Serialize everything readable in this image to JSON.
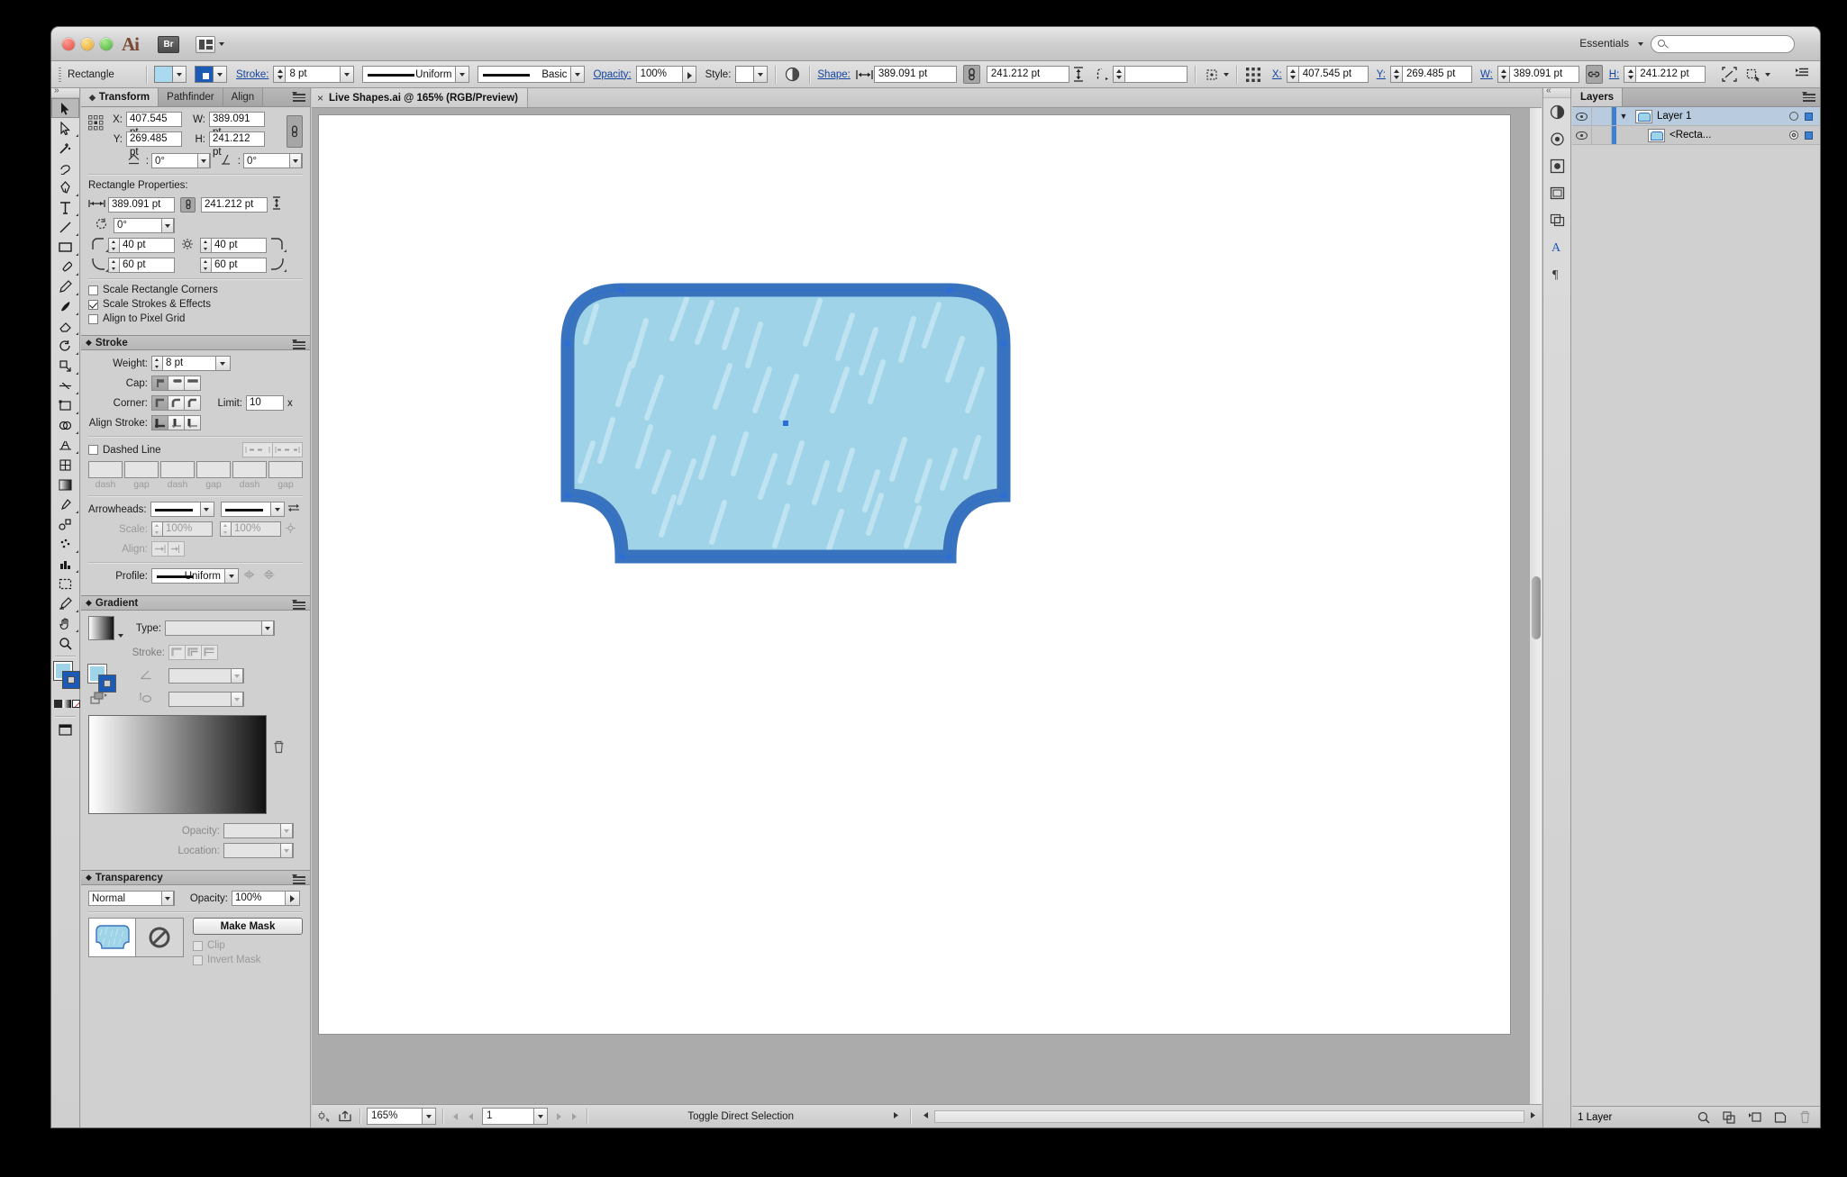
{
  "app": {
    "name": "Adobe Illustrator",
    "logo_text": "Ai",
    "bridge_label": "Br",
    "workspace": "Essentials",
    "search_placeholder": ""
  },
  "controlbar": {
    "object_label": "Rectangle",
    "stroke_label": "Stroke:",
    "stroke_weight": "8 pt",
    "variable_width_profile": "Uniform",
    "brush_definition": "Basic",
    "opacity_label": "Opacity:",
    "opacity_value": "100%",
    "style_label": "Style:",
    "shape_label": "Shape:",
    "shape_width": "389.091 pt",
    "shape_height": "241.212 pt",
    "corner_radius": "",
    "x_label": "X:",
    "x_value": "407.545 pt",
    "y_label": "Y:",
    "y_value": "269.485 pt",
    "w_label": "W:",
    "w_value": "389.091 pt",
    "h_label": "H:",
    "h_value": "241.212 pt"
  },
  "transform_panel": {
    "tabs": [
      "Transform",
      "Pathfinder",
      "Align"
    ],
    "active_tab": "Transform",
    "x_label": "X:",
    "x_value": "407.545 pt",
    "y_label": "Y:",
    "y_value": "269.485 pt",
    "w_label": "W:",
    "w_value": "389.091 pt",
    "h_label": "H:",
    "h_value": "241.212 pt",
    "rotate_value": "0°",
    "shear_value": "0°",
    "rect_props_title": "Rectangle Properties:",
    "rect_width": "389.091 pt",
    "rect_height": "241.212 pt",
    "rect_rotate": "0°",
    "corner_tl": "40 pt",
    "corner_tr": "40 pt",
    "corner_bl": "60 pt",
    "corner_br": "60 pt",
    "checkboxes": [
      {
        "label": "Scale Rectangle Corners",
        "checked": false
      },
      {
        "label": "Scale Strokes & Effects",
        "checked": true
      },
      {
        "label": "Align to Pixel Grid",
        "checked": false
      }
    ]
  },
  "stroke_panel": {
    "title": "Stroke",
    "weight_label": "Weight:",
    "weight_value": "8 pt",
    "cap_label": "Cap:",
    "corner_label": "Corner:",
    "limit_label": "Limit:",
    "limit_value": "10",
    "limit_unit": "x",
    "align_stroke_label": "Align Stroke:",
    "dashed_line_label": "Dashed Line",
    "dashed_checked": false,
    "dash_labels": [
      "dash",
      "gap",
      "dash",
      "gap",
      "dash",
      "gap"
    ],
    "dash_values": [
      "",
      "",
      "",
      "",
      "",
      ""
    ],
    "arrowheads_label": "Arrowheads:",
    "scale_label": "Scale:",
    "scale_start": "100%",
    "scale_end": "100%",
    "align_label": "Align:",
    "profile_label": "Profile:",
    "profile_value": "Uniform"
  },
  "gradient_panel": {
    "title": "Gradient",
    "type_label": "Type:",
    "type_value": "",
    "stroke_label": "Stroke:",
    "angle_value": "",
    "aspect_value": "",
    "opacity_label": "Opacity:",
    "opacity_value": "",
    "location_label": "Location:",
    "location_value": ""
  },
  "transparency_panel": {
    "title": "Transparency",
    "blend_mode": "Normal",
    "opacity_label": "Opacity:",
    "opacity_value": "100%",
    "make_mask_label": "Make Mask",
    "clip_label": "Clip",
    "clip_checked": false,
    "invert_mask_label": "Invert Mask",
    "invert_checked": false
  },
  "document": {
    "tab_title": "Live Shapes.ai @ 165% (RGB/Preview)",
    "zoom": "165%",
    "artboard_number": "1",
    "status_text": "Toggle Direct Selection"
  },
  "layers_panel": {
    "title": "Layers",
    "rows": [
      {
        "name": "Layer 1",
        "selected": true,
        "expanded": true
      },
      {
        "name": "<Recta...",
        "selected": false,
        "expanded": false
      }
    ],
    "footer_count": "1 Layer"
  },
  "artwork": {
    "fill_color": "#9ed3e8",
    "stroke_color": "#3a73bd",
    "stripe_color": "#bfe2f0",
    "anchor_color": "#2b6fd6",
    "selection_color": "#3f7fd0"
  }
}
